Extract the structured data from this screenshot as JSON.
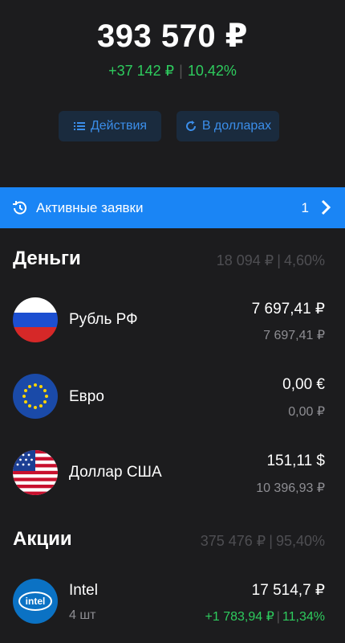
{
  "portfolio": {
    "total": "393 570 ₽",
    "change_abs": "+37 142 ₽",
    "change_pct": "10,42%"
  },
  "actions": {
    "actions_label": "Действия",
    "currency_label": "В долларах"
  },
  "orders": {
    "label": "Активные заявки",
    "count": "1"
  },
  "money": {
    "title": "Деньги",
    "sum": "18 094 ₽",
    "pct": "4,60%",
    "items": [
      {
        "name": "Рубль РФ",
        "value": "7 697,41 ₽",
        "value_rub": "7 697,41 ₽"
      },
      {
        "name": "Евро",
        "value": "0,00 €",
        "value_rub": "0,00 ₽"
      },
      {
        "name": "Доллар США",
        "value": "151,11 $",
        "value_rub": "10 396,93 ₽"
      }
    ]
  },
  "stocks": {
    "title": "Акции",
    "sum": "375 476 ₽",
    "pct": "95,40%",
    "items": [
      {
        "name": "Intel",
        "qty": "4 шт",
        "value": "17 514,7 ₽",
        "change_abs": "+1 783,94 ₽",
        "change_pct": "11,34%"
      }
    ]
  },
  "colors": {
    "background": "#1c1c1e",
    "accent": "#1a85f5",
    "positive": "#2ecc5e",
    "muted": "#8e8e93"
  }
}
